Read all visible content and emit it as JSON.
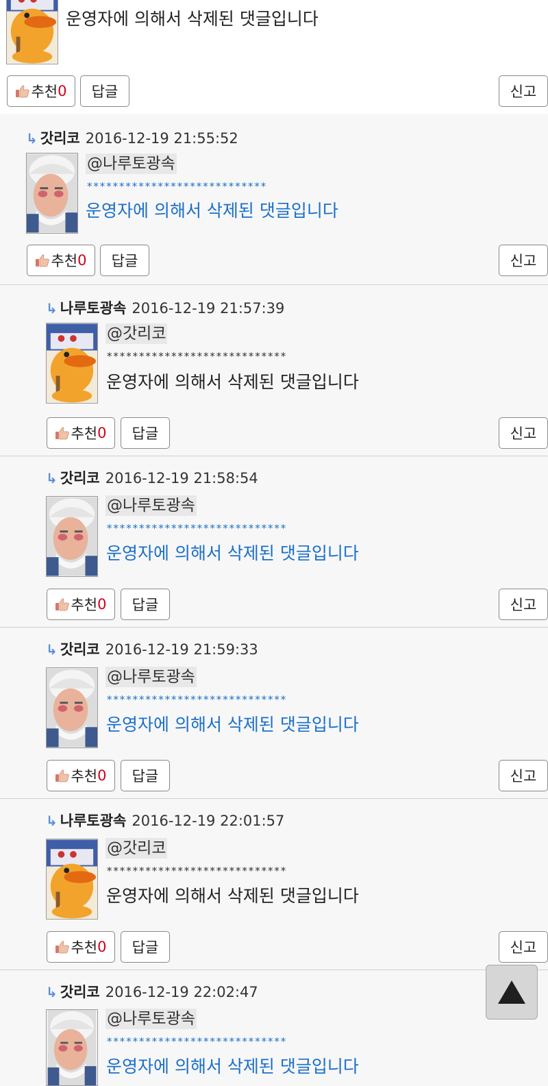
{
  "top": {
    "deleted_text": "운영자에 의해서 삭제된 댓글입니다",
    "recommend_label": "추천",
    "recommend_count": "0",
    "reply_label": "답글",
    "report_label": "신고"
  },
  "comments": [
    {
      "author": "갓리코",
      "date": "2016-12-19 21:55:52",
      "mention": "@나루토광속",
      "stars": "****************************",
      "deleted_text": "운영자에 의해서 삭제된 댓글입니다",
      "recommend_label": "추천",
      "recommend_count": "0",
      "reply_label": "답글",
      "report_label": "신고"
    },
    {
      "author": "나루토광속",
      "date": "2016-12-19 21:57:39",
      "mention": "@갓리코",
      "stars": "****************************",
      "deleted_text": "운영자에 의해서 삭제된 댓글입니다",
      "recommend_label": "추천",
      "recommend_count": "0",
      "reply_label": "답글",
      "report_label": "신고"
    },
    {
      "author": "갓리코",
      "date": "2016-12-19 21:58:54",
      "mention": "@나루토광속",
      "stars": "****************************",
      "deleted_text": "운영자에 의해서 삭제된 댓글입니다",
      "recommend_label": "추천",
      "recommend_count": "0",
      "reply_label": "답글",
      "report_label": "신고"
    },
    {
      "author": "갓리코",
      "date": "2016-12-19 21:59:33",
      "mention": "@나루토광속",
      "stars": "****************************",
      "deleted_text": "운영자에 의해서 삭제된 댓글입니다",
      "recommend_label": "추천",
      "recommend_count": "0",
      "reply_label": "답글",
      "report_label": "신고"
    },
    {
      "author": "나루토광속",
      "date": "2016-12-19 22:01:57",
      "mention": "@갓리코",
      "stars": "****************************",
      "deleted_text": "운영자에 의해서 삭제된 댓글입니다",
      "recommend_label": "추천",
      "recommend_count": "0",
      "reply_label": "답글",
      "report_label": "신고"
    },
    {
      "author": "갓리코",
      "date": "2016-12-19 22:02:47",
      "mention": "@나루토광속",
      "stars": "****************************",
      "deleted_text": "운영자에 의해서 삭제된 댓글입니다"
    }
  ],
  "reply_arrow_icon": "reply-arrow-icon",
  "scroll_top_icon": "triangle-up-icon",
  "colors": {
    "link_blue": "#1a6fc9",
    "count_red": "#d0021b",
    "panel": "#f7f7f7"
  }
}
